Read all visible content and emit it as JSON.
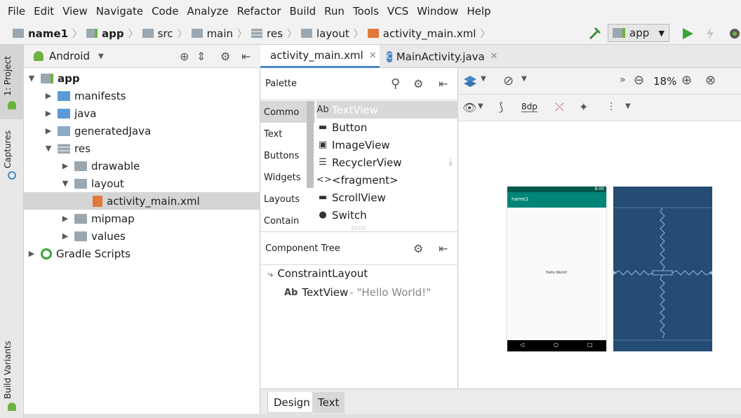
{
  "menu": [
    "File",
    "Edit",
    "View",
    "Navigate",
    "Code",
    "Analyze",
    "Refactor",
    "Build",
    "Run",
    "Tools",
    "VCS",
    "Window",
    "Help"
  ],
  "breadcrumb": [
    "name1",
    "app",
    "src",
    "main",
    "res",
    "layout",
    "activity_main.xml"
  ],
  "run_config": "app",
  "left_strip": {
    "project_tab": "1: Project",
    "captures_tab": "Captures",
    "build_variants_tab": "Build Variants"
  },
  "project_panel": {
    "view_mode": "Android",
    "tree": [
      {
        "label": "app",
        "bold": true
      },
      {
        "label": "manifests"
      },
      {
        "label": "java"
      },
      {
        "label": "generatedJava"
      },
      {
        "label": "res"
      },
      {
        "label": "drawable"
      },
      {
        "label": "layout"
      },
      {
        "label": "activity_main.xml"
      },
      {
        "label": "mipmap"
      },
      {
        "label": "values"
      },
      {
        "label": "Gradle Scripts"
      }
    ]
  },
  "editor_tabs": [
    {
      "label": "activity_main.xml",
      "active": true
    },
    {
      "label": "MainActivity.java",
      "active": false
    }
  ],
  "palette": {
    "title": "Palette",
    "categories": [
      "Commo",
      "Text",
      "Buttons",
      "Widgets",
      "Layouts",
      "Contain"
    ],
    "items": [
      {
        "icon": "Ab",
        "label": "TextView",
        "selected": true
      },
      {
        "icon": "▬",
        "label": "Button"
      },
      {
        "icon": "▣",
        "label": "ImageView"
      },
      {
        "icon": "☰",
        "label": "RecyclerView"
      },
      {
        "icon": "<>",
        "label": "<fragment>"
      },
      {
        "icon": "▬",
        "label": "ScrollView"
      },
      {
        "icon": "●",
        "label": "Switch"
      }
    ]
  },
  "component_tree": {
    "title": "Component Tree",
    "root": "ConstraintLayout",
    "child_label": "TextView",
    "child_value": "- \"Hello World!\""
  },
  "design_toolbar": {
    "zoom": "18%",
    "margin": "8dp"
  },
  "device": {
    "app_name": "name1",
    "time": "8:00",
    "hello_text": "Hello World!"
  },
  "bottom_tabs": [
    "Design",
    "Text"
  ],
  "colors": {
    "accent": "#4a88c7",
    "appbar": "#008577",
    "blueprint": "#254d73",
    "run_green": "#3aa53a"
  }
}
